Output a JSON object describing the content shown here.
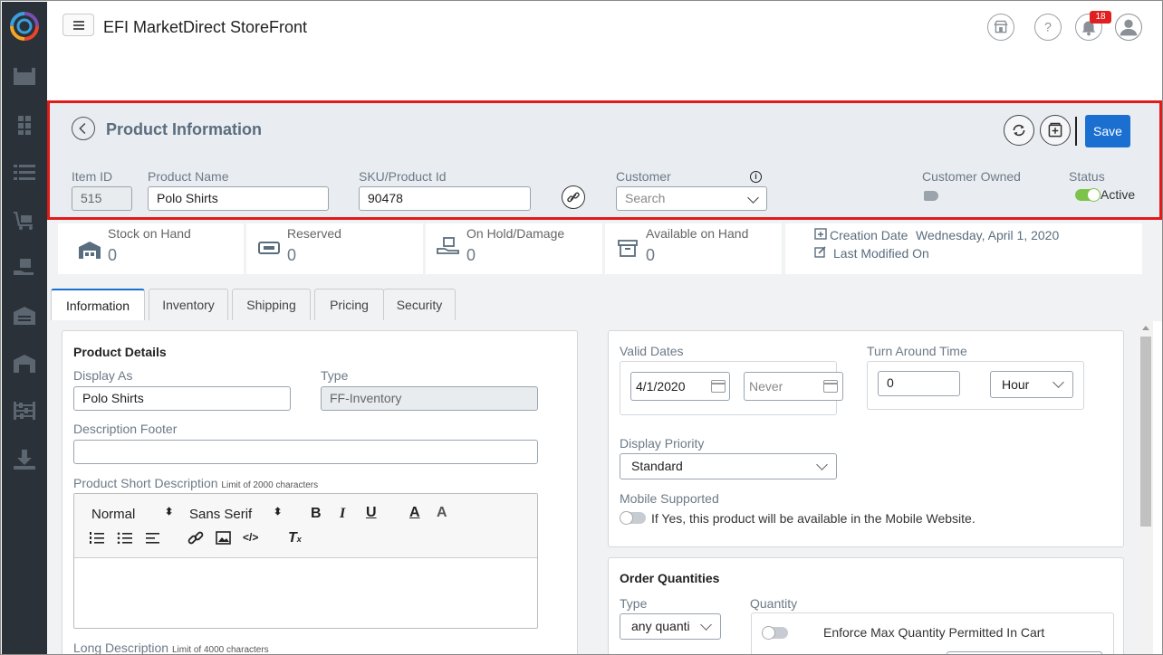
{
  "app": {
    "title": "EFI MarketDirect StoreFront",
    "notification_count": "18"
  },
  "product_info": {
    "title": "Product Information",
    "save_label": "Save",
    "item_id_label": "Item ID",
    "item_id_value": "515",
    "product_name_label": "Product Name",
    "product_name_value": "Polo Shirts",
    "sku_label": "SKU/Product Id",
    "sku_value": "90478",
    "customer_label": "Customer",
    "customer_placeholder": "Search",
    "customer_owned_label": "Customer Owned",
    "status_label": "Status",
    "status_value": "Active"
  },
  "stats": {
    "stock_on_hand_label": "Stock on Hand",
    "stock_on_hand_value": "0",
    "reserved_label": "Reserved",
    "reserved_value": "0",
    "on_hold_label": "On Hold/Damage",
    "on_hold_value": "0",
    "available_label": "Available on Hand",
    "available_value": "0",
    "creation_date_label": "Creation Date",
    "creation_date_value": "Wednesday, April 1, 2020",
    "last_modified_label": "Last Modified On"
  },
  "tabs": [
    "Information",
    "Inventory",
    "Shipping",
    "Pricing",
    "Security"
  ],
  "product_details": {
    "heading": "Product Details",
    "display_as_label": "Display As",
    "display_as_value": "Polo Shirts",
    "type_label": "Type",
    "type_value": "FF-Inventory",
    "description_footer_label": "Description Footer",
    "short_desc_label": "Product Short Description",
    "short_desc_limit": "Limit of 2000 characters",
    "editor_format": "Normal",
    "editor_font": "Sans Serif",
    "long_desc_label": "Long Description",
    "long_desc_limit": "Limit of 4000 characters"
  },
  "right_panel": {
    "valid_dates_label": "Valid Dates",
    "start_date": "4/1/2020",
    "end_date_placeholder": "Never",
    "turn_around_label": "Turn Around Time",
    "turn_around_value": "0",
    "turn_around_unit": "Hour",
    "display_priority_label": "Display Priority",
    "display_priority_value": "Standard",
    "mobile_supported_label": "Mobile Supported",
    "mobile_supported_text": "If Yes, this product will be available in the Mobile Website."
  },
  "order_quantities": {
    "heading": "Order Quantities",
    "type_label": "Type",
    "type_value": "any quanti",
    "quantity_label": "Quantity",
    "enforce_max_label": "Enforce Max Quantity Permitted In Cart"
  },
  "colors": {
    "accent": "#1a6fd1",
    "highlight_border": "#e21a1a",
    "sidebar": "#2b3139",
    "toggle_on": "#7cc34a"
  }
}
